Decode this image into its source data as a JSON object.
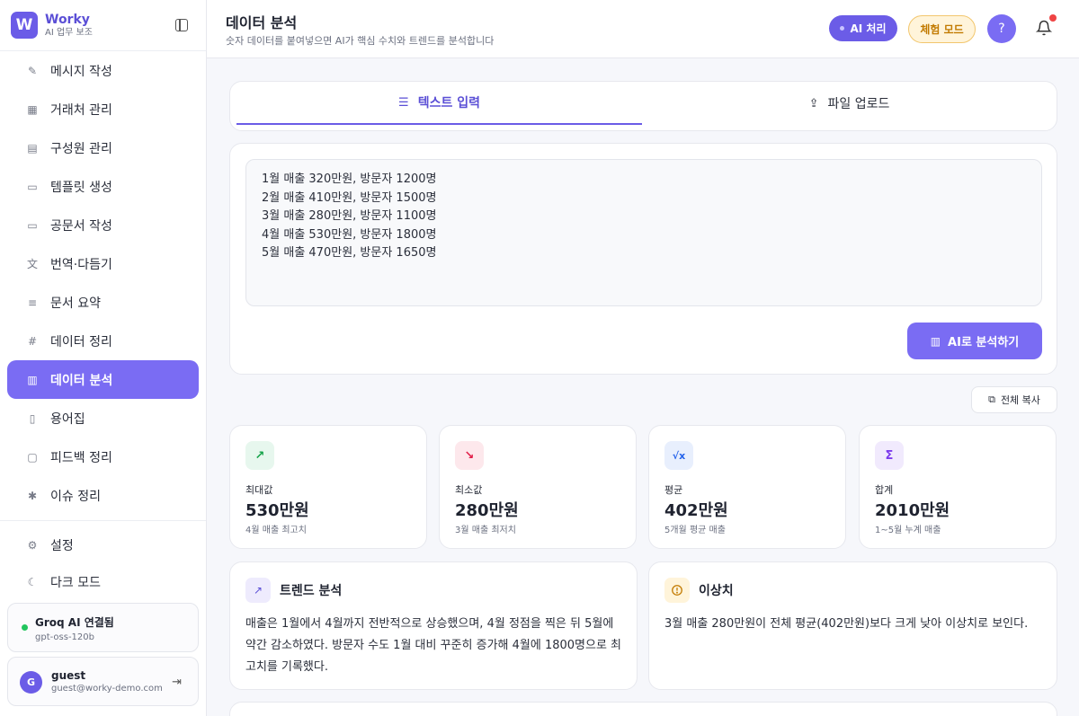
{
  "brand": {
    "logo": "W",
    "name": "Worky",
    "sub": "AI 업무 보조"
  },
  "nav": [
    {
      "label": "메시지 작성",
      "icon": "pencil-icon",
      "glyph": "✎"
    },
    {
      "label": "거래처 관리",
      "icon": "building-icon",
      "glyph": "▦"
    },
    {
      "label": "구성원 관리",
      "icon": "id-card-icon",
      "glyph": "▤"
    },
    {
      "label": "템플릿 생성",
      "icon": "file-icon",
      "glyph": "▭"
    },
    {
      "label": "공문서 작성",
      "icon": "document-icon",
      "glyph": "▭"
    },
    {
      "label": "번역·다듬기",
      "icon": "translate-icon",
      "glyph": "文"
    },
    {
      "label": "문서 요약",
      "icon": "list-icon",
      "glyph": "≡"
    },
    {
      "label": "데이터 정리",
      "icon": "hash-icon",
      "glyph": "#"
    },
    {
      "label": "데이터 분석",
      "icon": "bar-chart-icon",
      "glyph": "▥",
      "active": true
    },
    {
      "label": "용어집",
      "icon": "book-icon",
      "glyph": "▯"
    },
    {
      "label": "피드백 정리",
      "icon": "message-icon",
      "glyph": "▢"
    },
    {
      "label": "이슈 정리",
      "icon": "bug-icon",
      "glyph": "✱"
    }
  ],
  "settings": {
    "label": "설정",
    "glyph": "⚙"
  },
  "darkmode": {
    "label": "다크 모드",
    "glyph": "☾"
  },
  "connection": {
    "title": "Groq AI 연결됨",
    "model": "gpt-oss-120b",
    "status_color": "#22c55e"
  },
  "user": {
    "initial": "G",
    "name": "guest",
    "email": "guest@worky-demo.com"
  },
  "header": {
    "title": "데이터 분석",
    "subtitle": "숫자 데이터를 붙여넣으면 AI가 핵심 수치와 트렌드를 분석합니다",
    "ai_button": "AI 처리",
    "trial_button": "체험 모드",
    "help_button": "?"
  },
  "tabs": [
    {
      "label": "텍스트 입력",
      "glyph": "☰"
    },
    {
      "label": "파일 업로드",
      "glyph": "⇪"
    }
  ],
  "input": {
    "text": "1월 매출 320만원, 방문자 1200명\n2월 매출 410만원, 방문자 1500명\n3월 매출 280만원, 방문자 1100명\n4월 매출 530만원, 방문자 1800명\n5월 매출 470만원, 방문자 1650명",
    "analyze_button": "AI로 분석하기"
  },
  "copy_button": "전체 복사",
  "stats": [
    {
      "label": "최대값",
      "value": "530만원",
      "desc": "4월 매출 최고치",
      "glyph": "↗",
      "icon": "trend-up-icon",
      "color": "#16a34a",
      "bg": "#e7f7ee"
    },
    {
      "label": "최소값",
      "value": "280만원",
      "desc": "3월 매출 최저치",
      "glyph": "↘",
      "icon": "trend-down-icon",
      "color": "#e11d48",
      "bg": "#fde8ec"
    },
    {
      "label": "평균",
      "value": "402만원",
      "desc": "5개월 평균 매출",
      "glyph": "√x",
      "icon": "sqrt-icon",
      "color": "#2563eb",
      "bg": "#e8effd"
    },
    {
      "label": "합계",
      "value": "2010만원",
      "desc": "1~5월 누계 매출",
      "glyph": "Σ",
      "icon": "sigma-icon",
      "color": "#7c3aed",
      "bg": "#f1eafd"
    }
  ],
  "trend": {
    "title": "트렌드 분석",
    "text": "매출은 1월에서 4월까지 전반적으로 상승했으며, 4월 정점을 찍은 뒤 5월에 약간 감소하였다. 방문자 수도 1월 대비 꾸준히 증가해 4월에 1800명으로 최고치를 기록했다.",
    "glyph": "↗"
  },
  "anomaly": {
    "title": "이상치",
    "text": "3월 매출 280만원이 전체 평균(402만원)보다 크게 낮아 이상치로 보인다.",
    "glyph": "!"
  },
  "colors": {
    "accent": "#6b5ce7",
    "accent_light": "#7a6cf3",
    "trial": "#c27a00"
  }
}
